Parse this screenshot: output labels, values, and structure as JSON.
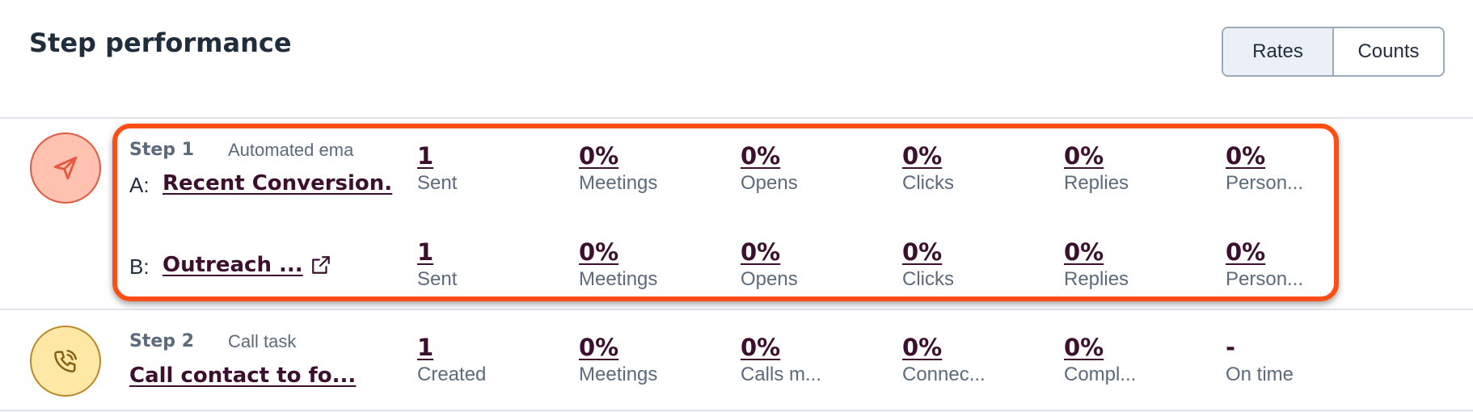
{
  "header": {
    "title": "Step performance",
    "toggle": {
      "rates_label": "Rates",
      "counts_label": "Counts",
      "selected": "Rates"
    }
  },
  "colors": {
    "accent_highlight": "#ff4e15",
    "link": "#3d0f2e",
    "email_icon_bg": "#ffc1b0",
    "call_icon_bg": "#fde8a6"
  },
  "steps": [
    {
      "label": "Step 1",
      "type": "Automated ema",
      "icon": "send-icon",
      "variants": [
        {
          "letter": "A:",
          "name": "Recent Conversion.",
          "metrics": [
            {
              "value": "1",
              "label": "Sent"
            },
            {
              "value": "0%",
              "label": "Meetings"
            },
            {
              "value": "0%",
              "label": "Opens"
            },
            {
              "value": "0%",
              "label": "Clicks"
            },
            {
              "value": "0%",
              "label": "Replies"
            },
            {
              "value": "0%",
              "label": "Person..."
            }
          ]
        },
        {
          "letter": "B:",
          "name": "Outreach ...",
          "icon": "external-link-icon",
          "metrics": [
            {
              "value": "1",
              "label": "Sent"
            },
            {
              "value": "0%",
              "label": "Meetings"
            },
            {
              "value": "0%",
              "label": "Opens"
            },
            {
              "value": "0%",
              "label": "Clicks"
            },
            {
              "value": "0%",
              "label": "Replies"
            },
            {
              "value": "0%",
              "label": "Person..."
            }
          ]
        }
      ]
    },
    {
      "label": "Step 2",
      "type": "Call task",
      "icon": "phone-icon",
      "name": "Call contact to fo...",
      "metrics": [
        {
          "value": "1",
          "label": "Created"
        },
        {
          "value": "0%",
          "label": "Meetings"
        },
        {
          "value": "0%",
          "label": "Calls m..."
        },
        {
          "value": "0%",
          "label": "Connec..."
        },
        {
          "value": "0%",
          "label": "Compl..."
        },
        {
          "value": "-",
          "label": "On time"
        }
      ]
    }
  ]
}
